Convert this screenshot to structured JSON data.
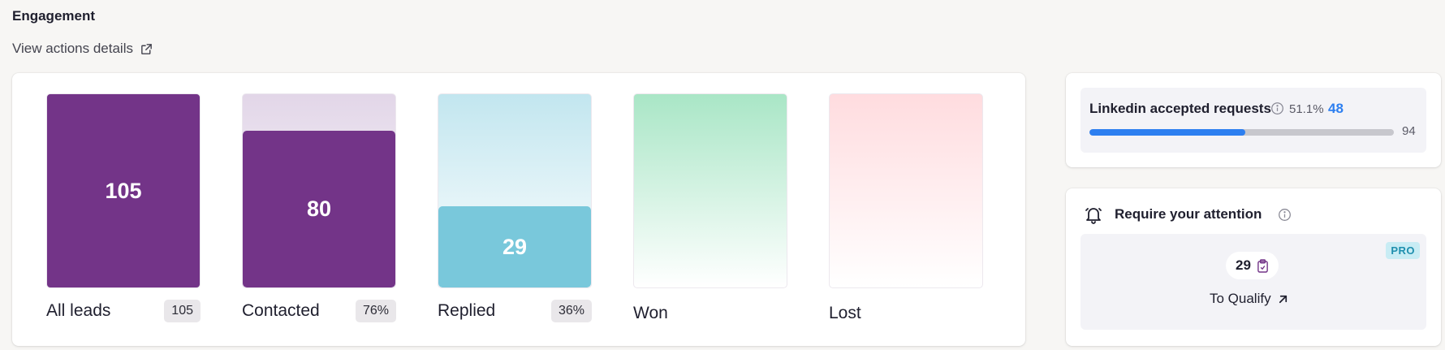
{
  "header": {
    "title": "Engagement",
    "details_link": "View actions details"
  },
  "funnel": {
    "stages": [
      {
        "label": "All leads",
        "value": "105",
        "badge": "105",
        "fill_fraction": 1.0,
        "color": "#733488",
        "bg_gradient": [
          "#733488",
          "#733488"
        ]
      },
      {
        "label": "Contacted",
        "value": "80",
        "badge": "76%",
        "fill_fraction": 0.81,
        "color": "#733488",
        "bg_gradient": [
          "#e2d6e8",
          "#ffffff"
        ]
      },
      {
        "label": "Replied",
        "value": "29",
        "badge": "36%",
        "fill_fraction": 0.42,
        "color": "#79c8db",
        "bg_gradient": [
          "#c2e6ef",
          "#ffffff"
        ]
      },
      {
        "label": "Won",
        "value": "",
        "badge": "",
        "fill_fraction": 0,
        "color": "#9fe0bc",
        "bg_gradient": [
          "#a9e6c6",
          "#ffffff"
        ]
      },
      {
        "label": "Lost",
        "value": "",
        "badge": "",
        "fill_fraction": 0,
        "color": "#ffd9dc",
        "bg_gradient": [
          "#ffdcdf",
          "#ffffff"
        ]
      }
    ]
  },
  "linkedin": {
    "title": "Linkedin accepted requests",
    "percent": "51.1%",
    "accepted": "48",
    "total": "94",
    "progress_fraction": 0.511,
    "accent": "#2d7ff0"
  },
  "attention": {
    "title": "Require your attention",
    "badge": "PRO",
    "count": "29",
    "action_label": "To Qualify"
  },
  "icons": {
    "external_link": "external-link-icon",
    "info": "info-icon",
    "bell": "bell-icon",
    "clipboard": "clipboard-icon",
    "arrow": "arrow-up-right-icon"
  }
}
